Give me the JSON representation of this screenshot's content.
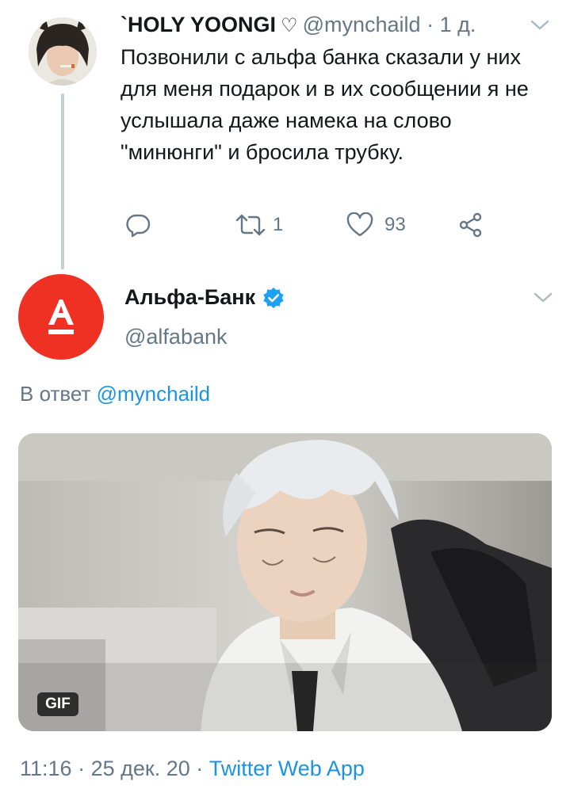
{
  "tweet": {
    "display_name": "`HOLY YOONGI",
    "heart_symbol": "♡",
    "handle": "@mynchaild",
    "separator": "·",
    "time_ago": "1 д.",
    "text": "Позвонили с альфа банка сказали у них для меня подарок и в их сообщении я не услышала даже намека на слово \"минюнги\" и бросила трубку.",
    "retweet_count": "1",
    "like_count": "93"
  },
  "reply": {
    "display_name": "Альфа-Банк",
    "verified": true,
    "handle": "@alfabank",
    "logo_letter": "А",
    "reply_prefix": "В ответ",
    "reply_to_handle": "@mynchaild",
    "media_badge": "GIF",
    "time": "11:16",
    "separator": "·",
    "date": "25 дек. 20",
    "source": "Twitter Web App"
  },
  "icons": {
    "reply": "reply-icon",
    "retweet": "retweet-icon",
    "like": "heart-icon",
    "share": "share-icon",
    "caret": "chevron-down-icon",
    "verified": "verified-badge-icon"
  },
  "colors": {
    "link": "#1b95e0",
    "secondary_text": "#657786",
    "alfa_red": "#ef3124",
    "verified_blue": "#1da1f2"
  }
}
